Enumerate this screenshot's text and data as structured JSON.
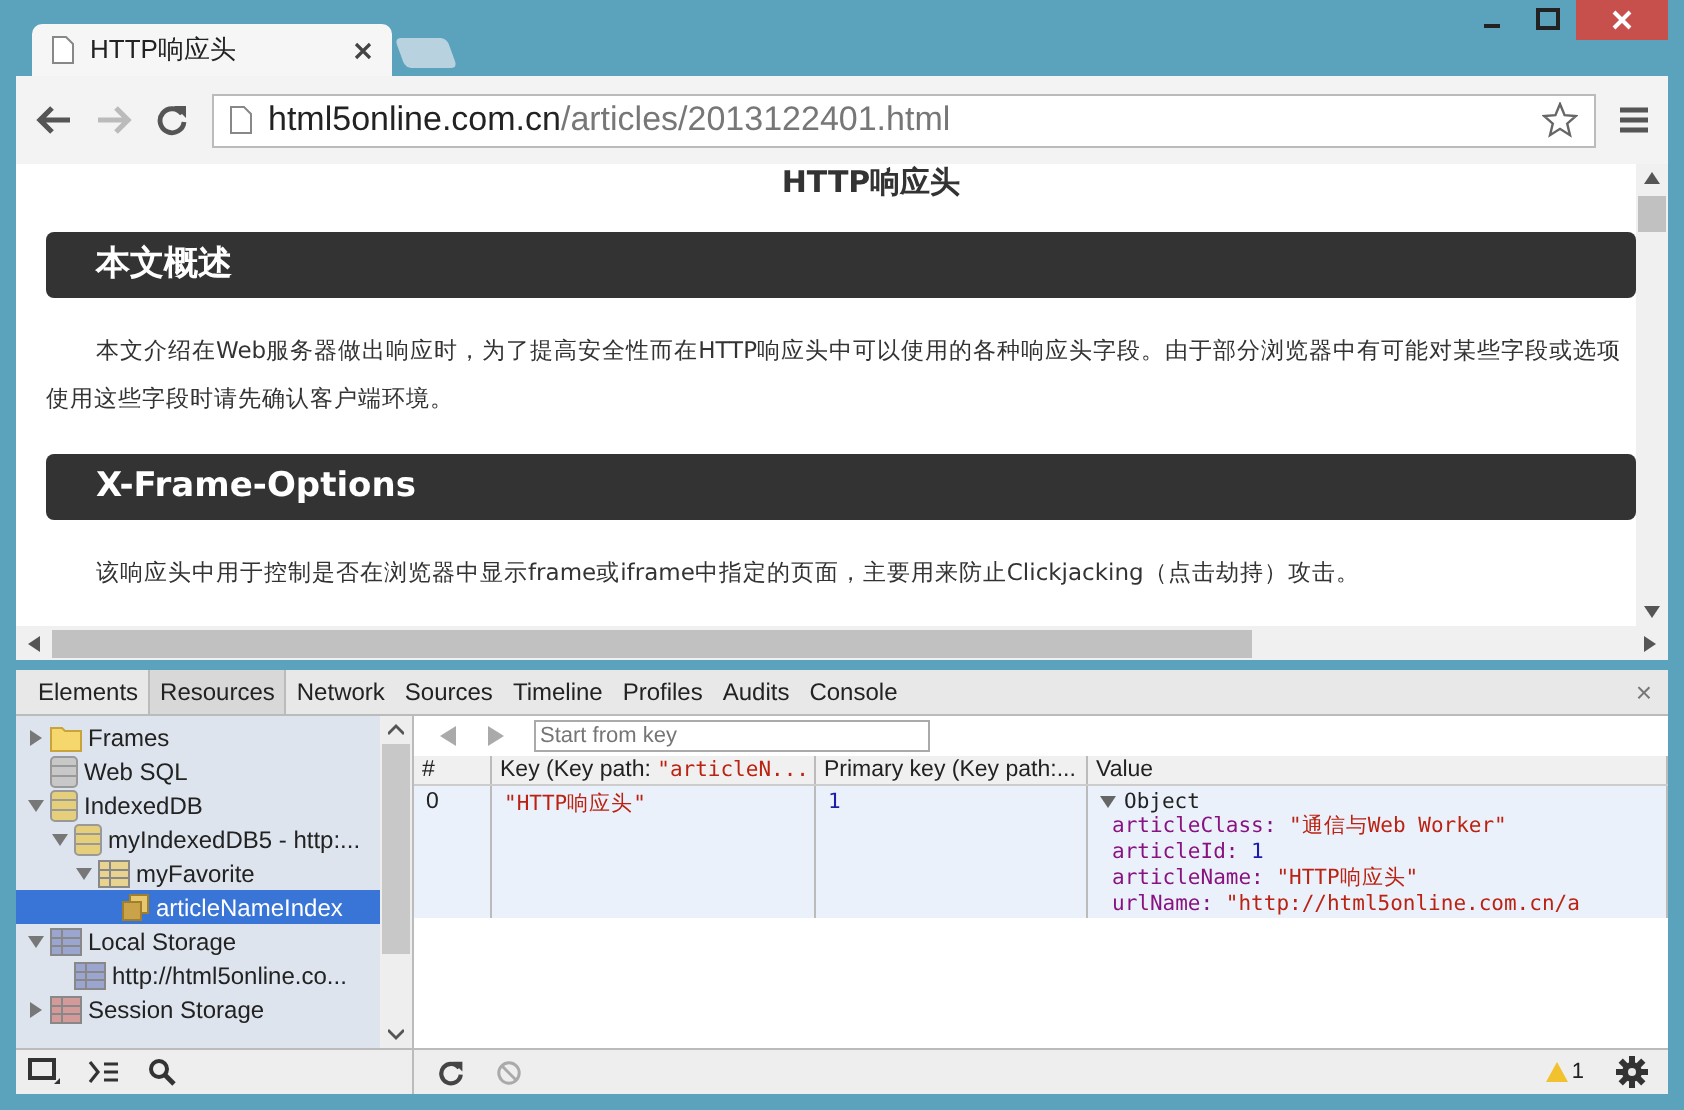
{
  "tabs": [
    {
      "title": "HTTP响应头",
      "selected": true
    }
  ],
  "address": {
    "host": "html5online.com.cn",
    "path": "/articles/2013122401.html"
  },
  "page": {
    "title": "HTTP响应头",
    "sections": [
      {
        "heading": "本文概述",
        "paragraphs": [
          [
            "本文介绍在Web服务器做出响应时，为了提高安全性而在HTTP响应头中可以使用的各种响应头字段。由于部分浏览器中有可能对某些字段或选项",
            "使用这些字段时请先确认客户端环境。"
          ]
        ]
      },
      {
        "heading": "X-Frame-Options",
        "paragraphs": [
          [
            "该响应头中用于控制是否在浏览器中显示frame或iframe中指定的页面，主要用来防止Clickjacking（点击劫持）攻击。"
          ]
        ]
      }
    ]
  },
  "devtools": {
    "panels": [
      {
        "label": "Elements",
        "selected": false
      },
      {
        "label": "Resources",
        "selected": true
      },
      {
        "label": "Network",
        "selected": false
      },
      {
        "label": "Sources",
        "selected": false
      },
      {
        "label": "Timeline",
        "selected": false
      },
      {
        "label": "Profiles",
        "selected": false
      },
      {
        "label": "Audits",
        "selected": false
      },
      {
        "label": "Console",
        "selected": false
      }
    ],
    "close": "×",
    "tree": [
      {
        "label": "Frames",
        "kind": "folder",
        "expanded": false,
        "selected": false
      },
      {
        "label": "Web SQL",
        "kind": "database",
        "selected": false
      },
      {
        "label": "IndexedDB",
        "kind": "idb",
        "expanded": true,
        "selected": false,
        "children": [
          {
            "label": "myIndexedDB5 - http:...",
            "kind": "idb",
            "expanded": true,
            "selected": false,
            "children": [
              {
                "label": "myFavorite",
                "kind": "store",
                "expanded": true,
                "selected": false,
                "children": [
                  {
                    "label": "articleNameIndex",
                    "kind": "index",
                    "selected": true
                  }
                ]
              }
            ]
          }
        ]
      },
      {
        "label": "Local Storage",
        "kind": "local",
        "expanded": true,
        "selected": false,
        "children": [
          {
            "label": "http://html5online.co...",
            "kind": "local",
            "selected": false
          }
        ]
      },
      {
        "label": "Session Storage",
        "kind": "session",
        "expanded": false,
        "selected": false
      }
    ],
    "start_key": {
      "placeholder": "Start from key"
    },
    "columns": [
      {
        "label": "#"
      },
      {
        "label": "Key (Key path: ",
        "key_path": "\"articleN..."
      },
      {
        "label": "Primary key (Key path:..."
      },
      {
        "label": "Value"
      }
    ],
    "rows": [
      {
        "index": "0",
        "key": "\"HTTP响应头\"",
        "primary_key": "1",
        "value": {
          "label": "Object",
          "expanded": true,
          "properties": [
            {
              "name": "articleClass:",
              "value": "\"通信与Web Worker\"",
              "kind": "string"
            },
            {
              "name": "articleId:",
              "value": "1",
              "kind": "number"
            },
            {
              "name": "articleName:",
              "value": "\"HTTP响应头\"",
              "kind": "string"
            },
            {
              "name": "urlName:",
              "value": "\"http://html5online.com.cn/a",
              "kind": "string"
            }
          ]
        }
      }
    ],
    "warnings": "1"
  }
}
